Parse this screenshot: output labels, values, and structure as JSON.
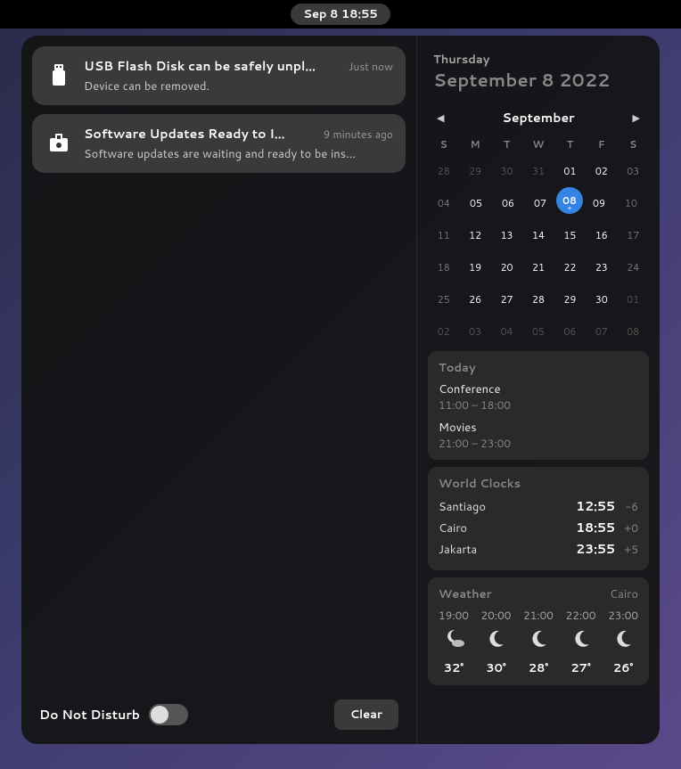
{
  "topbar": {
    "datetime": "Sep 8  18:55"
  },
  "notifications": [
    {
      "icon": "usb-icon",
      "title": "USB Flash Disk can be safely unpl…",
      "time": "Just now",
      "desc": "Device can be removed."
    },
    {
      "icon": "software-icon",
      "title": "Software Updates Ready to I…",
      "time": "9 minutes ago",
      "desc": "Software updates are waiting and ready to be ins…"
    }
  ],
  "dnd": {
    "label": "Do Not Disturb"
  },
  "clear_label": "Clear",
  "date": {
    "weekday": "Thursday",
    "full": "September 8 2022"
  },
  "calendar": {
    "month": "September",
    "dow": [
      "S",
      "M",
      "T",
      "W",
      "T",
      "F",
      "S"
    ],
    "weeks": [
      [
        {
          "d": "28",
          "dim": true
        },
        {
          "d": "29",
          "dim": true
        },
        {
          "d": "30",
          "dim": true
        },
        {
          "d": "31",
          "dim": true
        },
        {
          "d": "01"
        },
        {
          "d": "02"
        },
        {
          "d": "03",
          "wknd": true
        }
      ],
      [
        {
          "d": "04",
          "wknd": true
        },
        {
          "d": "05"
        },
        {
          "d": "06"
        },
        {
          "d": "07"
        },
        {
          "d": "08",
          "today": true,
          "dot": true
        },
        {
          "d": "09"
        },
        {
          "d": "10",
          "wknd": true
        }
      ],
      [
        {
          "d": "11",
          "wknd": true
        },
        {
          "d": "12"
        },
        {
          "d": "13"
        },
        {
          "d": "14"
        },
        {
          "d": "15"
        },
        {
          "d": "16"
        },
        {
          "d": "17",
          "wknd": true
        }
      ],
      [
        {
          "d": "18",
          "wknd": true
        },
        {
          "d": "19"
        },
        {
          "d": "20"
        },
        {
          "d": "21"
        },
        {
          "d": "22"
        },
        {
          "d": "23"
        },
        {
          "d": "24",
          "wknd": true
        }
      ],
      [
        {
          "d": "25",
          "wknd": true
        },
        {
          "d": "26"
        },
        {
          "d": "27"
        },
        {
          "d": "28"
        },
        {
          "d": "29"
        },
        {
          "d": "30"
        },
        {
          "d": "01",
          "dim": true
        }
      ],
      [
        {
          "d": "02",
          "dim": true
        },
        {
          "d": "03",
          "dim": true
        },
        {
          "d": "04",
          "dim": true
        },
        {
          "d": "05",
          "dim": true
        },
        {
          "d": "06",
          "dim": true
        },
        {
          "d": "07",
          "dim": true
        },
        {
          "d": "08",
          "dim": true
        }
      ]
    ]
  },
  "events": {
    "title": "Today",
    "items": [
      {
        "name": "Conference",
        "time": "11:00 – 18:00"
      },
      {
        "name": "Movies",
        "time": "21:00 – 23:00"
      }
    ]
  },
  "clocks": {
    "title": "World Clocks",
    "items": [
      {
        "city": "Santiago",
        "time": "12:55",
        "offset": "-6"
      },
      {
        "city": "Cairo",
        "time": "18:55",
        "offset": "+0"
      },
      {
        "city": "Jakarta",
        "time": "23:55",
        "offset": "+5"
      }
    ]
  },
  "weather": {
    "title": "Weather",
    "city": "Cairo",
    "forecast": [
      {
        "time": "19:00",
        "icon": "moon-cloud",
        "temp": "32°"
      },
      {
        "time": "20:00",
        "icon": "moon",
        "temp": "30°"
      },
      {
        "time": "21:00",
        "icon": "moon",
        "temp": "28°"
      },
      {
        "time": "22:00",
        "icon": "moon",
        "temp": "27°"
      },
      {
        "time": "23:00",
        "icon": "moon",
        "temp": "26°"
      }
    ]
  }
}
